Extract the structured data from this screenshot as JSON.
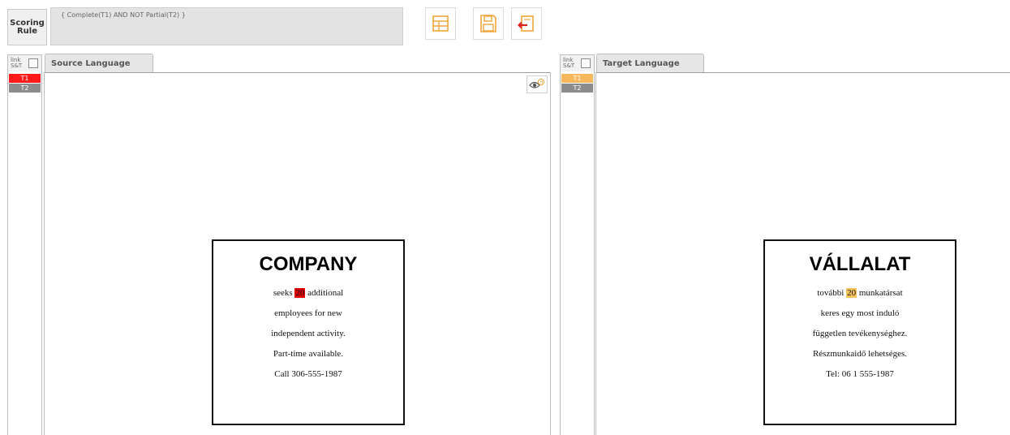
{
  "toolbar": {
    "scoring_label_line1": "Scoring",
    "scoring_label_line2": "Rule",
    "rule_text": "{ Complete(T1) AND NOT Partial(T2) }",
    "icons": [
      "form-edit-icon",
      "save-icon",
      "exit-icon"
    ],
    "accent_color": "#f0a53b"
  },
  "source": {
    "link_label_line1": "link",
    "link_label_line2": "S&T",
    "tab_label": "Source Language",
    "tags": [
      {
        "label": "T1",
        "color": "#ff1a1a"
      },
      {
        "label": "T2",
        "color": "#8c8c8c"
      }
    ],
    "ad": {
      "title": "COMPANY",
      "line1_before": "seeks ",
      "line1_highlight": "20",
      "line1_after": " additional",
      "line2": "employees for new",
      "line3": "independent activity.",
      "line4": "Part-time available.",
      "line5": "Call 306-555-1987",
      "highlight_color": "#e00000"
    }
  },
  "target": {
    "link_label_line1": "link",
    "link_label_line2": "S&T",
    "tab_label": "Target Language",
    "tags": [
      {
        "label": "T1",
        "color": "#f6b85a"
      },
      {
        "label": "T2",
        "color": "#8c8c8c"
      }
    ],
    "ad": {
      "title": "VÁLLALAT",
      "line1_before": "további ",
      "line1_highlight": "20",
      "line1_after": " munkatársat",
      "line2": "keres egy most induló",
      "line3": "független tevékenységhez.",
      "line4": "Részmunkaidő lehetséges.",
      "line5": "Tel: 06 1 555-1987",
      "highlight_color": "#f6c35a"
    }
  }
}
